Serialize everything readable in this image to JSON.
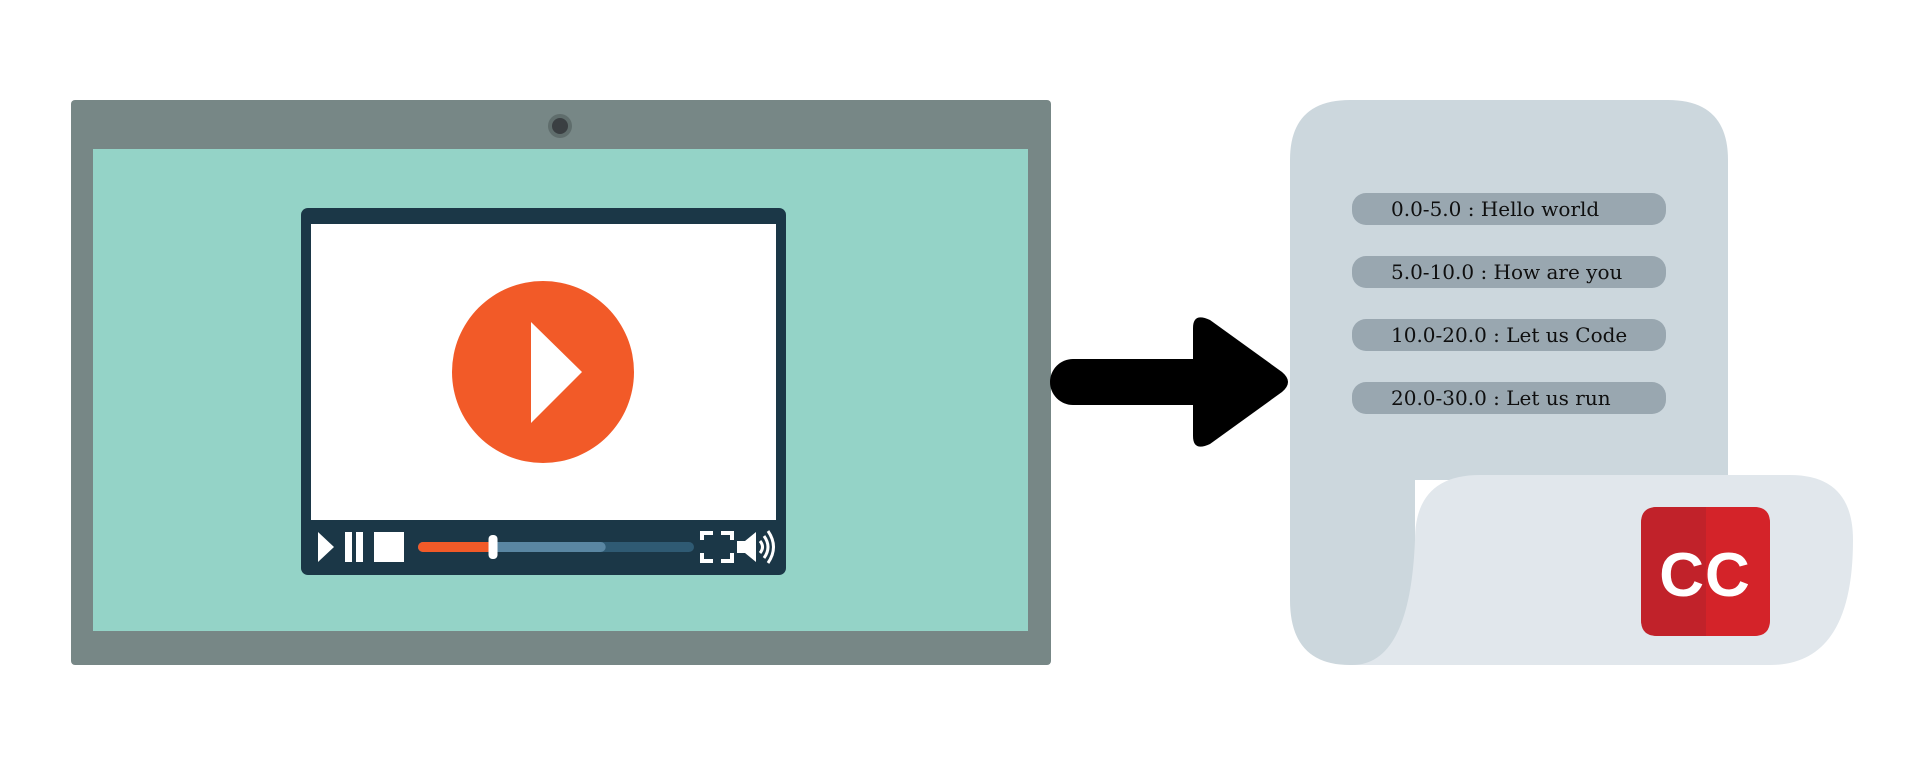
{
  "colors": {
    "background": "#ffffff",
    "laptop_frame": "#778786",
    "laptop_screen": "#94d3c7",
    "webcam": "#3a3f42",
    "player_frame": "#1b3747",
    "player_screen": "#ffffff",
    "play_circle": "#f25a28",
    "progress_played": "#f25a28",
    "progress_buffered": "#5a86a2",
    "progress_track": "#2f5a73",
    "arrow": "#000000",
    "scroll_back": "#ccd7dd",
    "scroll_front": "#e1e7ec",
    "caption_pill": "#99a7b0",
    "caption_text": "#0f0f0f",
    "cc_badge": "#cf2027",
    "cc_badge_dark": "#c1222a"
  },
  "player": {
    "progress_played_fraction": 0.27,
    "progress_buffered_fraction": 0.68
  },
  "icons": {
    "play": "play-icon",
    "pause": "pause-icon",
    "stop": "stop-icon",
    "fullscreen": "fullscreen-icon",
    "volume": "volume-icon",
    "big_play": "play-circle-icon",
    "arrow": "arrow-right-icon",
    "cc": "closed-captions-icon"
  },
  "captions": [
    "0.0-5.0 : Hello world",
    "5.0-10.0 : How are you",
    "10.0-20.0 : Let us Code",
    "20.0-30.0 : Let us run"
  ],
  "cc_badge": {
    "label": "CC"
  }
}
